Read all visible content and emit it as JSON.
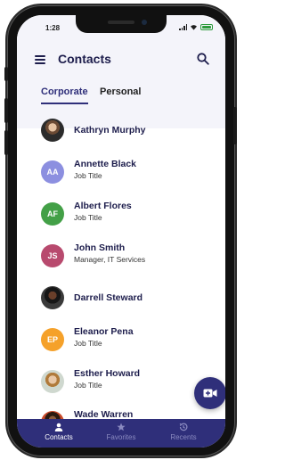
{
  "status_bar": {
    "time": "1:28"
  },
  "header": {
    "title": "Contacts"
  },
  "tabs": [
    {
      "label": "Corporate",
      "active": true
    },
    {
      "label": "Personal",
      "active": false
    }
  ],
  "contacts": [
    {
      "name": "Kathryn Murphy",
      "subtitle": "",
      "initials": "",
      "avatar": "photo"
    },
    {
      "name": "Annette Black",
      "subtitle": "Job Title",
      "initials": "AA",
      "avatar_color": "#8c8fe0"
    },
    {
      "name": "Albert Flores",
      "subtitle": "Job Title",
      "initials": "AF",
      "avatar_color": "#43a047"
    },
    {
      "name": "John Smith",
      "subtitle": "Manager, IT Services",
      "initials": "JS",
      "avatar_color": "#b84a6e"
    },
    {
      "name": "Darrell Steward",
      "subtitle": "",
      "initials": "",
      "avatar": "photo"
    },
    {
      "name": "Eleanor Pena",
      "subtitle": "Job Title",
      "initials": "EP",
      "avatar_color": "#f5a12a"
    },
    {
      "name": "Esther Howard",
      "subtitle": "Job Title",
      "initials": "",
      "avatar": "photo"
    },
    {
      "name": "Wade Warren",
      "subtitle": "",
      "initials": "",
      "avatar": "photo"
    }
  ],
  "fab": {
    "icon": "video-call-icon"
  },
  "bottom_nav": [
    {
      "label": "Contacts",
      "icon": "person-icon",
      "active": true
    },
    {
      "label": "Favorites",
      "icon": "star-icon",
      "active": false
    },
    {
      "label": "Recents",
      "icon": "history-icon",
      "active": false
    }
  ],
  "colors": {
    "primary": "#2f2f7a",
    "header_bg": "#f4f4fa"
  }
}
